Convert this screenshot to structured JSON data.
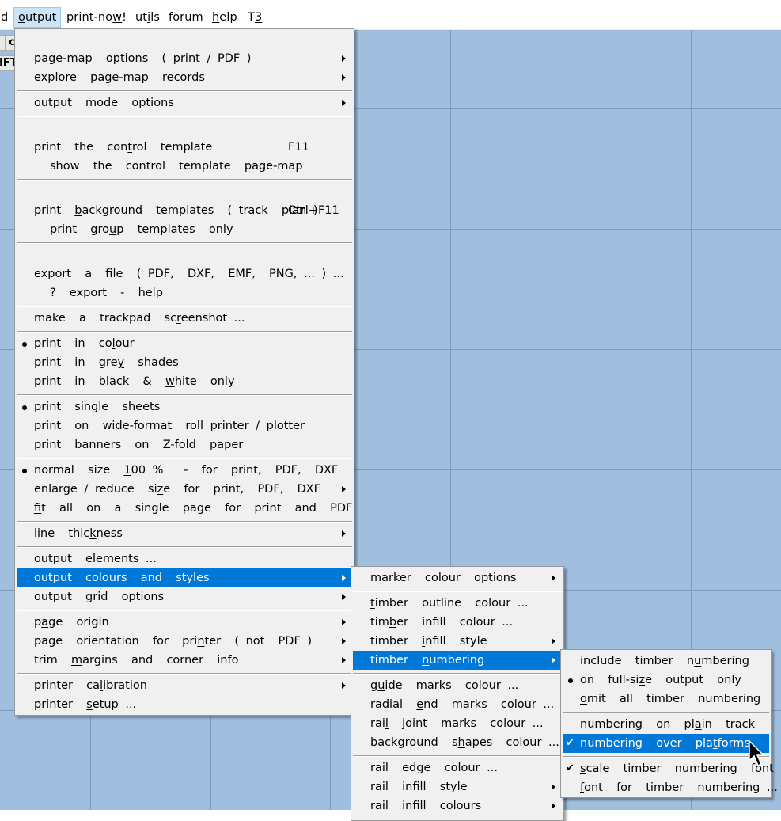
{
  "menubar": {
    "items": [
      {
        "label": "d"
      },
      {
        "label": "output",
        "ul": "o",
        "rest": "utput"
      },
      {
        "label": "print-now!",
        "pre": "print-no",
        "ul": "w",
        "rest": "!"
      },
      {
        "label": "utils",
        "pre": "ut",
        "ul": "i",
        "rest": "ls"
      },
      {
        "label": "forum"
      },
      {
        "label": "help",
        "ul": "h",
        "rest": "elp"
      },
      {
        "label": "T3",
        "pre": "T",
        "ul": "3"
      }
    ]
  },
  "toolbar": {
    "btn1": "c",
    "btn2": "IFT"
  },
  "colors": {
    "canvas": "#a0bfdf",
    "grid": "#7b9ebf",
    "menu_bg": "#f0f0f0",
    "highlight": "#0078d7"
  },
  "output_menu": {
    "items": {
      "page_map_options": "page-map  options  ( print / PDF )",
      "explore_page_map": "explore  page-map  records",
      "output_mode": {
        "pre": "output  mode  o",
        "ul": "p",
        "rest": "tions"
      },
      "print_control": {
        "pre": "print  the  con",
        "ul": "t",
        "rest": "rol  template",
        "shortcut": "F11"
      },
      "show_control_pagemap": "show  the  control  template  page-map",
      "print_background": {
        "pre": "print  ",
        "ul": "b",
        "rest": "ackground  templates  ( track  plan )",
        "shortcut": "Ctrl+F11"
      },
      "print_group": {
        "pre": "print  gro",
        "ul": "u",
        "rest": "p  templates  only"
      },
      "export_file": {
        "pre": "e",
        "ul": "x",
        "rest": "port  a  file  ( PDF,  DXF,  EMF,  PNG, ... ) ..."
      },
      "export_help": {
        "pre": "?  export  -  ",
        "ul": "h",
        "rest": "elp"
      },
      "trackpad_screenshot": {
        "pre": "make  a  trackpad  sc",
        "ul": "r",
        "rest": "eenshot ..."
      },
      "print_colour": {
        "pre": "print  in  co",
        "ul": "l",
        "rest": "our",
        "selected": true
      },
      "print_grey": {
        "pre": "print  in  gre",
        "ul": "y",
        "rest": "  shades"
      },
      "print_bw": {
        "pre": "print  in  black  &  ",
        "ul": "w",
        "rest": "hite  only"
      },
      "print_single": {
        "label": "print  single  sheets",
        "selected": true
      },
      "print_wide": "print  on  wide-format  roll printer / plotter",
      "print_banners": "print  banners  on  Z-fold  paper",
      "normal_size": {
        "pre": "normal  size  ",
        "ul": "1",
        "rest": "00 %   -  for  print,  PDF,  DXF",
        "selected": true
      },
      "enlarge_reduce": {
        "pre": "enlarge / reduce  si",
        "ul": "z",
        "rest": "e  for  print,  PDF,  DXF"
      },
      "fit_all": {
        "pre": "",
        "ul": "f",
        "rest": "it  all  on  a  single  page  for  print  and  PDF"
      },
      "line_thickness": {
        "pre": "line  thic",
        "ul": "k",
        "rest": "ness"
      },
      "output_elements": {
        "pre": "output  ",
        "ul": "e",
        "rest": "lements ..."
      },
      "output_colours": {
        "pre": "output  ",
        "ul": "c",
        "rest": "olours  and  styles"
      },
      "output_grid": {
        "pre": "output  gri",
        "ul": "d",
        "rest": "  options"
      },
      "page_origin": {
        "pre": "p",
        "ul": "a",
        "rest": "ge  origin"
      },
      "page_orientation": {
        "pre": "page  orientation  for  pri",
        "ul": "n",
        "rest": "ter  ( not  PDF )"
      },
      "trim_margins": {
        "pre": "trim  ",
        "ul": "m",
        "rest": "argins  and  corner  info"
      },
      "printer_calibration": {
        "pre": "printer  ca",
        "ul": "l",
        "rest": "ibration"
      },
      "printer_setup": {
        "pre": "printer  ",
        "ul": "s",
        "rest": "etup ..."
      }
    }
  },
  "colours_menu": {
    "items": {
      "marker_colour": {
        "pre": "marker  c",
        "ul": "o",
        "rest": "lour  options"
      },
      "timber_outline": {
        "pre": "",
        "ul": "t",
        "rest": "imber  outline  colour ..."
      },
      "timber_infill_colour": {
        "pre": "tim",
        "ul": "b",
        "rest": "er  infill  colour ..."
      },
      "timber_infill_style": {
        "pre": "timber  ",
        "ul": "i",
        "rest": "nfill  style"
      },
      "timber_numbering": {
        "pre": "timber  ",
        "ul": "n",
        "rest": "umbering"
      },
      "guide_marks": {
        "pre": "g",
        "ul": "u",
        "rest": "ide  marks  colour ..."
      },
      "radial_end": {
        "pre": "radial  ",
        "ul": "e",
        "rest": "nd  marks  colour ..."
      },
      "rail_joint": {
        "pre": "rai",
        "ul": "l",
        "rest": "  joint  marks  colour ..."
      },
      "background_shapes": {
        "pre": "background  s",
        "ul": "h",
        "rest": "apes  colour ..."
      },
      "rail_edge": {
        "pre": "",
        "ul": "r",
        "rest": "ail  edge  colour ..."
      },
      "rail_infill_style": {
        "pre": "rail  infill  ",
        "ul": "s",
        "rest": "tyle"
      },
      "rail_infill_colours": "rail  infill  colours"
    }
  },
  "numbering_menu": {
    "items": {
      "include": {
        "pre": "include  timber  n",
        "ul": "u",
        "rest": "mbering"
      },
      "full_size_only": {
        "pre": "on  full-si",
        "ul": "z",
        "rest": "e  output  only",
        "selected": true
      },
      "omit_all": {
        "pre": "",
        "ul": "o",
        "rest": "mit  all  timber  numbering"
      },
      "plain_track": {
        "pre": "numbering  on  pl",
        "ul": "a",
        "rest": "in  track"
      },
      "over_platforms": {
        "pre": "numbering  over  pla",
        "ul": "t",
        "rest": "forms",
        "checked": true
      },
      "scale_font": {
        "pre": "",
        "ul": "s",
        "rest": "cale  timber  numbering  font",
        "checked": true
      },
      "font_for": {
        "pre": "",
        "ul": "f",
        "rest": "ont  for  timber  numbering ..."
      }
    }
  }
}
